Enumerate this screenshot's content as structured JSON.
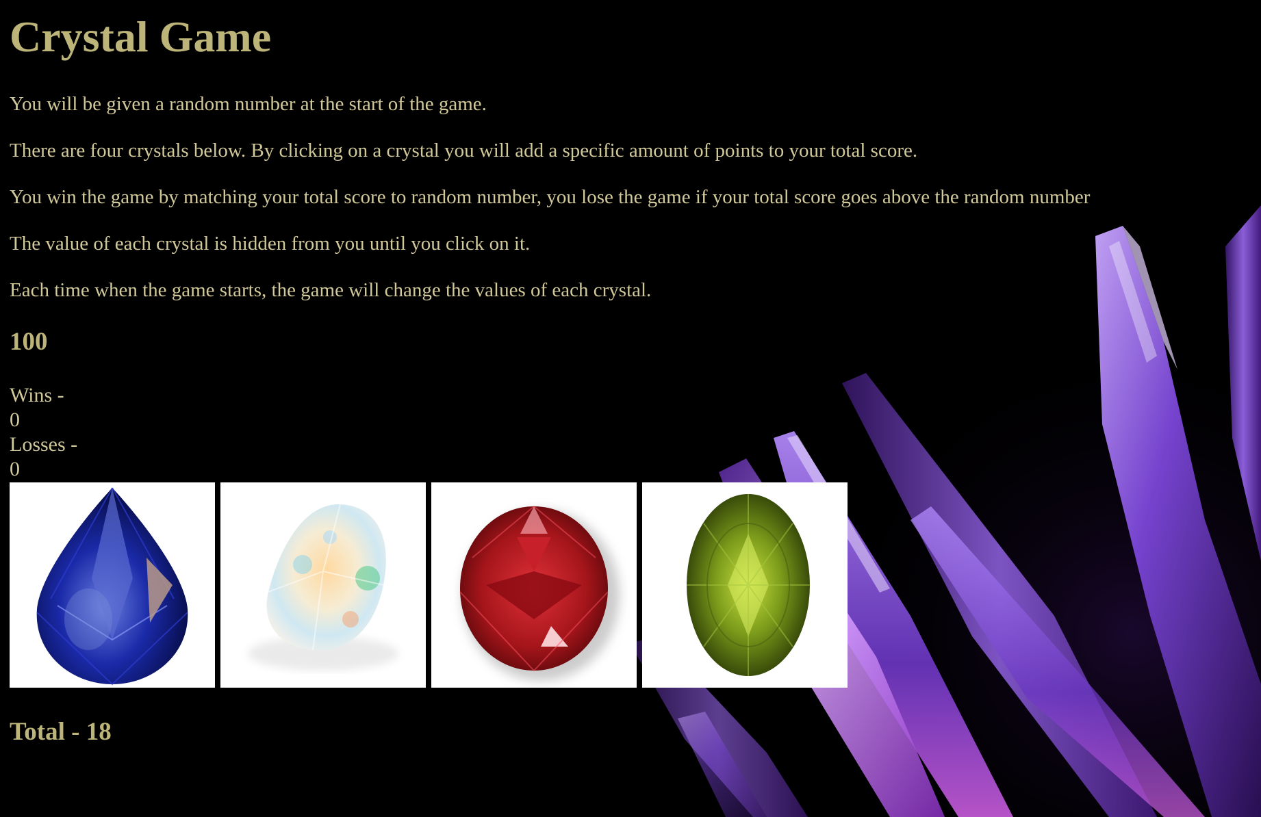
{
  "title": "Crystal Game",
  "instructions": [
    "You will be given a random number at the start of the game.",
    "There are four crystals below. By clicking on a crystal you will add a specific amount of points to your total score.",
    "You win the game by matching your total score to random number, you lose the game if your total score goes above the random number",
    "The value of each crystal is hidden from you until you click on it.",
    "Each time when the game starts, the game will change the values of each crystal."
  ],
  "random_number": "100",
  "wins_label": "Wins -",
  "wins_value": "0",
  "losses_label": "Losses -",
  "losses_value": "0",
  "crystals": [
    {
      "name": "blue-sapphire",
      "color": "#1a2aa8"
    },
    {
      "name": "opal",
      "color": "#f3e7c8"
    },
    {
      "name": "red-garnet",
      "color": "#a4151a"
    },
    {
      "name": "green-peridot",
      "color": "#7a9a1a"
    }
  ],
  "total": "Total - 18",
  "colors": {
    "heading": "#bcb478",
    "text": "#d1c99a",
    "background": "#000000",
    "accent_purple": "#8a5ad6"
  }
}
